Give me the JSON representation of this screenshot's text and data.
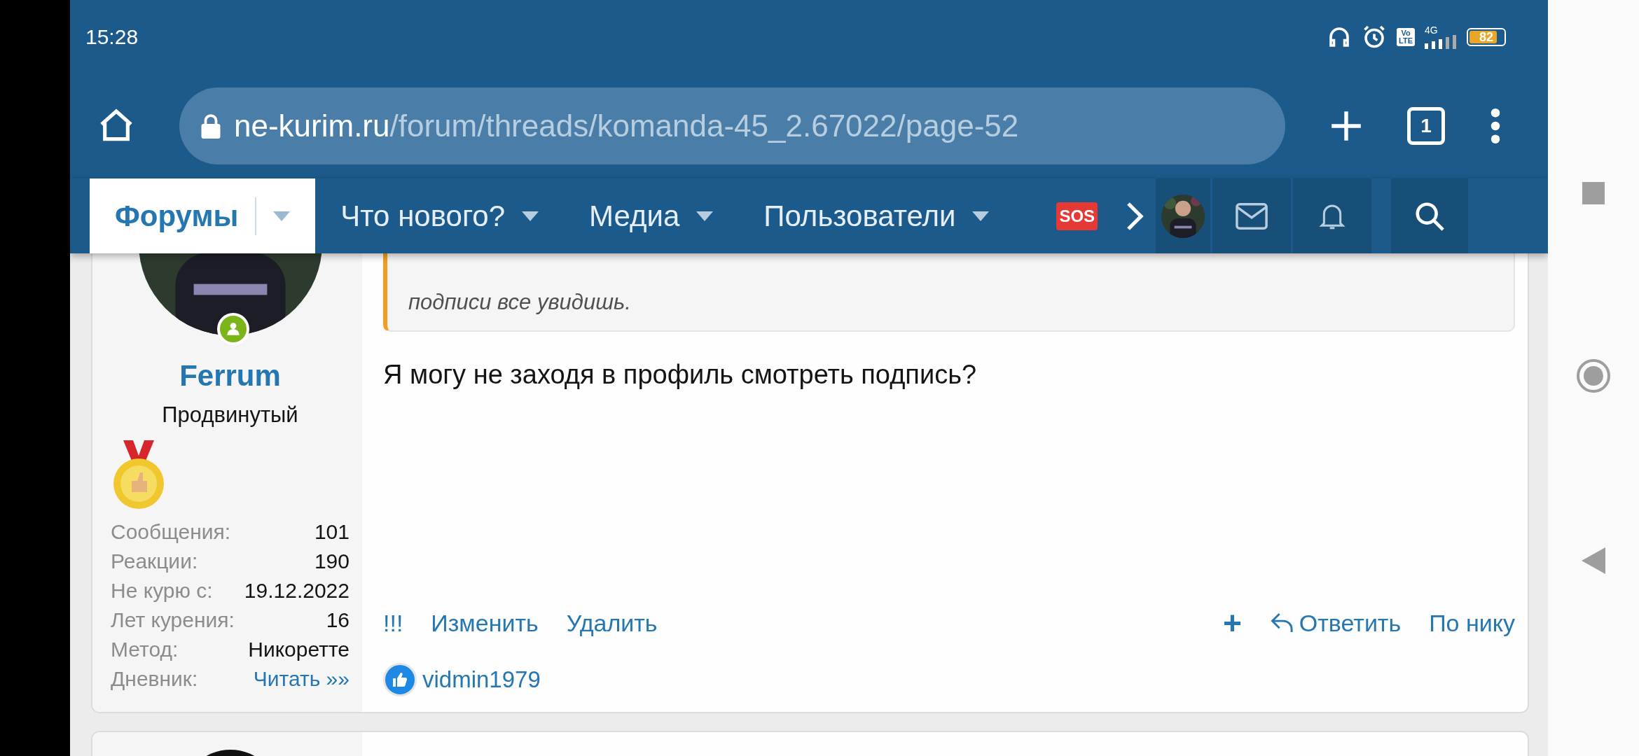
{
  "status_bar": {
    "time": "15:28",
    "volte": [
      "Vo",
      "LTE"
    ],
    "network": "4G",
    "battery": "82"
  },
  "browser": {
    "url_host": "ne-kurim.ru",
    "url_path": "/forum/threads/komanda-45_2.67022/page-52",
    "tab_count": "1"
  },
  "nav": {
    "tabs": [
      {
        "label": "Форумы",
        "selected": true
      },
      {
        "label": "Что нового?",
        "selected": false
      },
      {
        "label": "Медиа",
        "selected": false
      },
      {
        "label": "Пользователи",
        "selected": false
      }
    ],
    "sos": "SOS"
  },
  "post": {
    "author": {
      "name": "Ferrum",
      "title": "Продвинутый",
      "online": true,
      "stats": [
        {
          "label": "Сообщения:",
          "value": "101",
          "kind": "text"
        },
        {
          "label": "Реакции:",
          "value": "190",
          "kind": "text"
        },
        {
          "label": "Не курю с:",
          "value": "19.12.2022",
          "kind": "text"
        },
        {
          "label": "Лет курения:",
          "value": "16",
          "kind": "text"
        },
        {
          "label": "Метод:",
          "value": "Никоретте",
          "kind": "text"
        },
        {
          "label": "Дневник:",
          "value": "Читать »»",
          "kind": "link"
        }
      ]
    },
    "quote_text": "подписи все увидишь.",
    "body": "Я могу не заходя в профиль смотреть подпись?",
    "actions_left": [
      "!!!",
      "Изменить",
      "Удалить"
    ],
    "actions_right": [
      {
        "kind": "plus",
        "label": "+"
      },
      {
        "kind": "reply",
        "label": "Ответить"
      },
      {
        "kind": "link",
        "label": "По нику"
      }
    ],
    "reaction_user": "vidmin1979"
  }
}
